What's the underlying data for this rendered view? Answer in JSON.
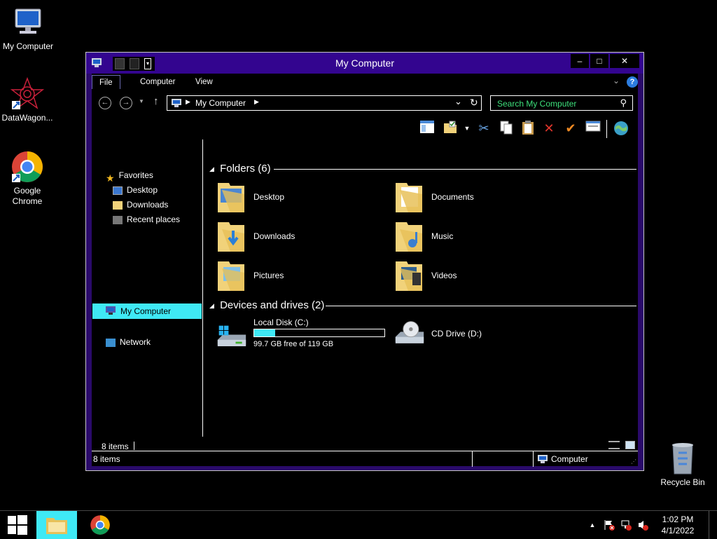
{
  "desktop": {
    "icons": [
      {
        "label": "My Computer"
      },
      {
        "label": "DataWagon..."
      },
      {
        "label": "Google\nChrome"
      },
      {
        "label": "Recycle Bin"
      }
    ]
  },
  "window": {
    "title": "My Computer",
    "controls": {
      "minimize": "–",
      "maximize": "□",
      "close": "✕"
    },
    "ribbon_tabs": [
      "File",
      "Computer",
      "View"
    ],
    "address": {
      "crumb": "My Computer"
    },
    "search": {
      "placeholder": "Search My Computer"
    },
    "nav": {
      "favorites": "Favorites",
      "items": [
        "Desktop",
        "Downloads",
        "Recent places"
      ],
      "my_computer": "My Computer",
      "network": "Network"
    },
    "groups": {
      "folders": {
        "title": "Folders (6)",
        "items": [
          "Desktop",
          "Documents",
          "Downloads",
          "Music",
          "Pictures",
          "Videos"
        ]
      },
      "drives": {
        "title": "Devices and drives (2)",
        "local_disk": {
          "name": "Local Disk (C:)",
          "free_text": "99.7 GB free of 119 GB",
          "used_fraction": 0.16
        },
        "cd_drive": {
          "name": "CD Drive (D:)"
        }
      }
    },
    "status": {
      "count": "8 items",
      "count2": "8 items",
      "location": "Computer"
    }
  },
  "taskbar": {
    "time": "1:02 PM",
    "date": "4/1/2022"
  },
  "colors": {
    "titlebar": "#33058f",
    "selection": "#3fe9f5",
    "search_text": "#3de07b",
    "folder": "#f1d27a"
  }
}
